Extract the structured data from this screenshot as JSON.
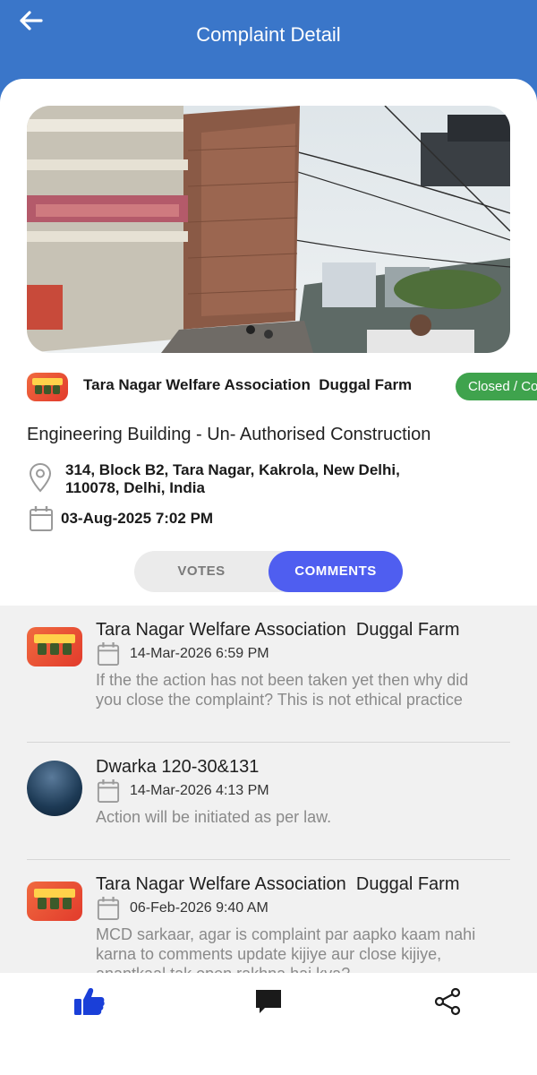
{
  "header": {
    "title": "Complaint Detail"
  },
  "complaint": {
    "organization": "Tara Nagar Welfare Association  Duggal Farm",
    "status": "Closed / Completed",
    "category": "Engineering Building - Un- Authorised Construction",
    "address": "314, Block B2, Tara Nagar, Kakrola, New Delhi, 110078, Delhi, India",
    "date": "03-Aug-2025 7:02 PM"
  },
  "tabs": {
    "votes": "VOTES",
    "comments": "COMMENTS",
    "active": "comments"
  },
  "comments": [
    {
      "author": "Tara Nagar Welfare Association  Duggal Farm",
      "date": "14-Mar-2026 6:59 PM",
      "text": "If the the action has not been taken yet then why did you close the complaint? This is not ethical practice"
    },
    {
      "author": "Dwarka 120-30&131",
      "date": "14-Mar-2026 4:13 PM",
      "text": "Action will be initiated as per law."
    },
    {
      "author": "Tara Nagar Welfare Association  Duggal Farm",
      "date": "06-Feb-2026 9:40 AM",
      "text": "MCD sarkaar, agar is complaint par aapko kaam nahi karna to comments update kijiye aur close kijiye, anantkaal tak open rakhna hai kya?"
    }
  ],
  "bottom_bar": {
    "items": [
      "thumbs-up-icon",
      "comment-icon",
      "share-icon"
    ],
    "active_color": "#1a3fd8"
  },
  "colors": {
    "header": "#3a76c9",
    "status_badge": "#3fa34d",
    "active_tab": "#4f5ef0"
  }
}
